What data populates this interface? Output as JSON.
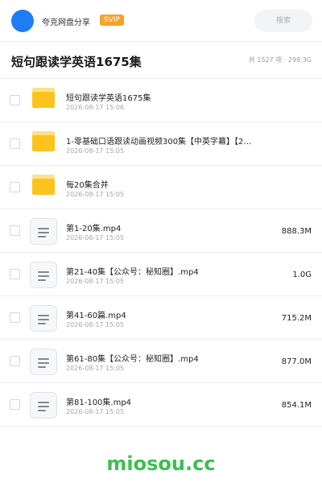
{
  "header": {
    "app_name": "夸克网盘分享",
    "badge": "SVIP",
    "search_placeholder": "搜索",
    "accent_color": "#1f7cf5",
    "badge_color": "#f6a12a"
  },
  "title_bar": {
    "title": "短句跟读学英语1675集",
    "stats": "共 1527 项 · 299.3G"
  },
  "files": [
    {
      "type": "folder",
      "icon": "folder-icon",
      "name": "短句跟读学英语1675集",
      "date": "2026-08-17 15:06",
      "size": ""
    },
    {
      "type": "folder",
      "icon": "folder-icon",
      "name": "1-零基础口语跟读动画视频300集【中英字幕】【2…",
      "date": "2026-08-17 15:05",
      "size": ""
    },
    {
      "type": "folder",
      "icon": "folder-icon",
      "name": "每20集合并",
      "date": "2026-08-17 15:05",
      "size": ""
    },
    {
      "type": "file",
      "icon": "video-file-icon",
      "name": "第1-20集.mp4",
      "date": "2026-08-17 15:05",
      "size": "888.3M"
    },
    {
      "type": "file",
      "icon": "video-file-icon",
      "name": "第21-40集【公众号：秘知圈】.mp4",
      "date": "2026-08-17 15:05",
      "size": "1.0G"
    },
    {
      "type": "file",
      "icon": "video-file-icon",
      "name": "第41-60篇.mp4",
      "date": "2026-08-17 15:05",
      "size": "715.2M"
    },
    {
      "type": "file",
      "icon": "video-file-icon",
      "name": "第61-80集【公众号：秘知圈】.mp4",
      "date": "2026-08-17 15:05",
      "size": "877.0M"
    },
    {
      "type": "file",
      "icon": "video-file-icon",
      "name": "第81-100集.mp4",
      "date": "2026-08-17 15:05",
      "size": "854.1M"
    }
  ],
  "watermark": "miosou.cc"
}
